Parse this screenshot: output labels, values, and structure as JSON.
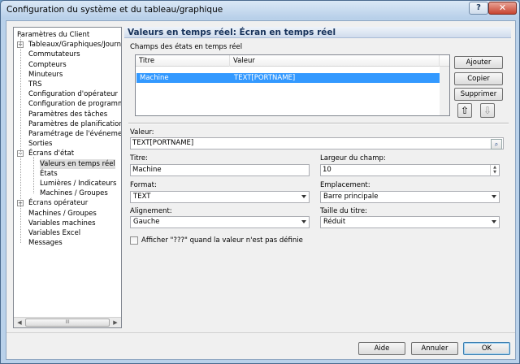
{
  "window": {
    "title": "Configuration du système et du tableau/graphique",
    "help_label": "?",
    "close_label": "✕"
  },
  "tree": {
    "items": [
      {
        "label": "Paramètres du Client"
      },
      {
        "label": "Tableaux/Graphiques/Journaux",
        "expander": "+"
      },
      {
        "label": "Commutateurs"
      },
      {
        "label": "Compteurs"
      },
      {
        "label": "Minuteurs"
      },
      {
        "label": "TRS"
      },
      {
        "label": "Configuration d'opérateur"
      },
      {
        "label": "Configuration de programme"
      },
      {
        "label": "Paramètres des tâches"
      },
      {
        "label": "Paramètres de planification"
      },
      {
        "label": "Paramétrage de l'événement"
      },
      {
        "label": "Sorties"
      },
      {
        "label": "Écrans d'état",
        "expander": "−"
      },
      {
        "label": "Valeurs en temps réel",
        "selected": true
      },
      {
        "label": "États"
      },
      {
        "label": "Lumières / Indicateurs"
      },
      {
        "label": "Machines / Groupes"
      },
      {
        "label": "Écrans opérateur",
        "expander": "+"
      },
      {
        "label": "Machines / Groupes"
      },
      {
        "label": "Variables machines"
      },
      {
        "label": "Variables Excel"
      },
      {
        "label": "Messages"
      }
    ],
    "scroll_left": "◀",
    "scroll_right": "▶",
    "scroll_thumb": "III"
  },
  "panel": {
    "title": "Valeurs en temps réel: Écran en temps réel",
    "fields_label": "Champs des états en temps réel",
    "columns": [
      "Titre",
      "Valeur"
    ],
    "rows": [
      {
        "title": "Machine",
        "value": "TEXT[PORTNAME]"
      }
    ],
    "buttons": {
      "add": "Ajouter",
      "copy": "Copier",
      "delete": "Supprimer",
      "up": "⇧",
      "down": "⇩"
    },
    "value_label": "Valeur:",
    "value": "TEXT[PORTNAME]",
    "title_label": "Titre:",
    "title_value": "Machine",
    "width_label": "Largeur du champ:",
    "width_value": "10",
    "format_label": "Format:",
    "format_value": "TEXT",
    "location_label": "Emplacement:",
    "location_value": "Barre principale",
    "alignment_label": "Alignement:",
    "alignment_value": "Gauche",
    "title_size_label": "Taille du titre:",
    "title_size_value": "Réduit",
    "show_undefined_label": "Afficher \"???\" quand la valeur n'est pas définie"
  },
  "footer": {
    "help": "Aide",
    "cancel": "Annuler",
    "ok": "OK"
  },
  "colors": {
    "selection": "#3399ff",
    "header_text": "#17325a"
  }
}
